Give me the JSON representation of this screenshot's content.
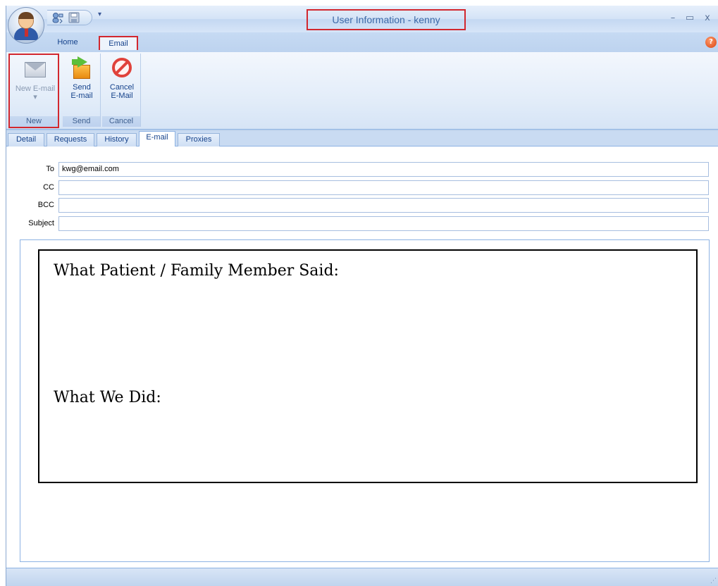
{
  "window": {
    "title": "User Information - kenny",
    "controls": {
      "minimize": "–",
      "maximize": "▭",
      "close": "x"
    }
  },
  "quick_access": {
    "icons": [
      "user-sync-icon",
      "save-icon"
    ],
    "dropdown": "▾"
  },
  "ribbon": {
    "tabs": [
      {
        "label": "Home",
        "active": false
      },
      {
        "label": "Email",
        "active": true
      }
    ],
    "help": "?",
    "groups": [
      {
        "label": "New",
        "buttons": [
          {
            "label_1": "New E-mail",
            "label_2": "▾",
            "icon": "envelope-icon",
            "enabled": false
          }
        ]
      },
      {
        "label": "Send",
        "buttons": [
          {
            "label_1": "Send",
            "label_2": "E-mail",
            "icon": "send-icon",
            "enabled": true
          }
        ]
      },
      {
        "label": "Cancel",
        "buttons": [
          {
            "label_1": "Cancel",
            "label_2": "E-Mail",
            "icon": "cancel-icon",
            "enabled": true
          }
        ]
      }
    ]
  },
  "detail_tabs": [
    {
      "label": "Detail",
      "active": false
    },
    {
      "label": "Requests",
      "active": false
    },
    {
      "label": "History",
      "active": false
    },
    {
      "label": "E-mail",
      "active": true
    },
    {
      "label": "Proxies",
      "active": false
    }
  ],
  "email_form": {
    "to": {
      "label": "To",
      "value": "kwg@email.com"
    },
    "cc": {
      "label": "CC",
      "value": ""
    },
    "bcc": {
      "label": "BCC",
      "value": ""
    },
    "subject": {
      "label": "Subject",
      "value": ""
    }
  },
  "body": {
    "line_1": "What Patient / Family Member Said:",
    "line_2": "What We Did:"
  },
  "colors": {
    "highlight_border": "#d2272e",
    "ribbon_blue": "#bfd3ec",
    "text_blue": "#15428b"
  }
}
